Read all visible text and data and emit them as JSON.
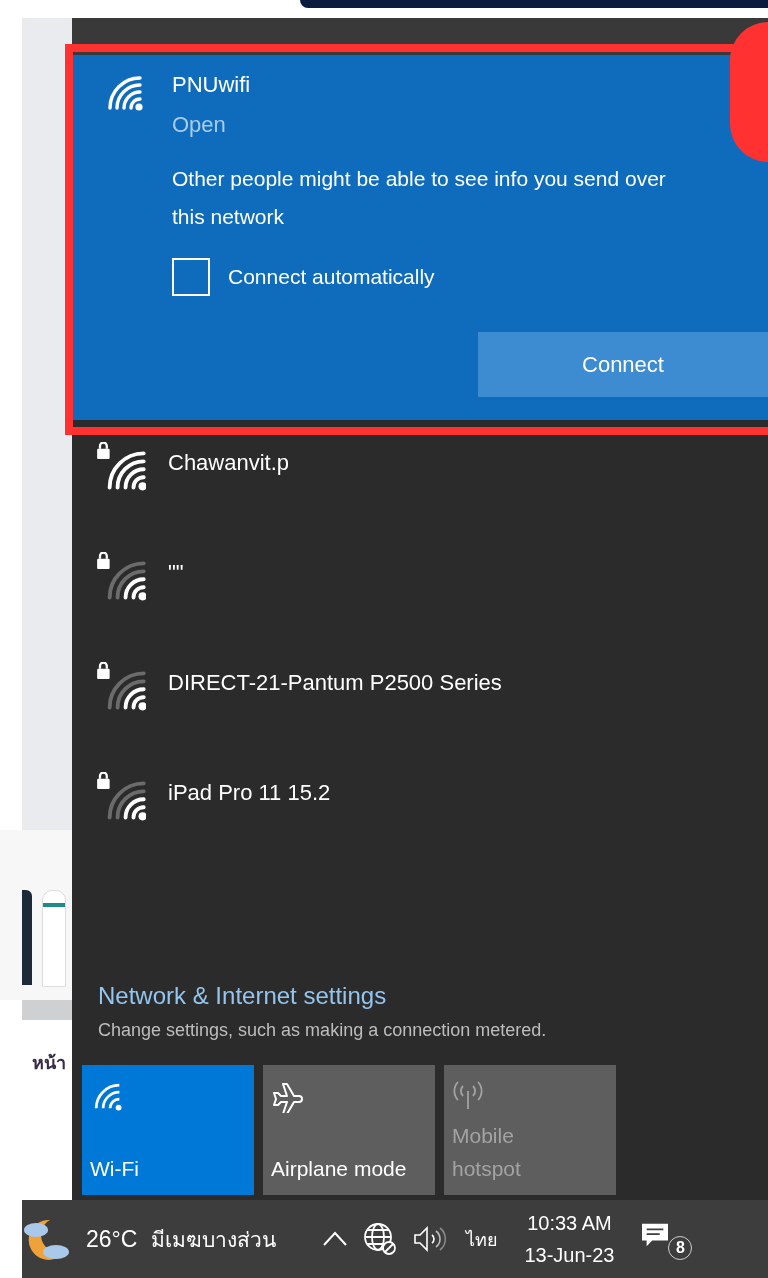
{
  "background": {
    "text": "หน้า"
  },
  "selected_network": {
    "name": "PNUwifi",
    "status": "Open",
    "warning": "Other people might be able to see info you send over this network",
    "connect_automatically": {
      "label": "Connect automatically",
      "checked": false
    },
    "connect_button": "Connect"
  },
  "networks": [
    {
      "name": "Chawanvit.p",
      "kind": "strong"
    },
    {
      "name": "\"\"",
      "kind": "weak"
    },
    {
      "name": "DIRECT-21-Pantum P2500 Series",
      "kind": "weak"
    },
    {
      "name": "iPad Pro 11 15.2",
      "kind": "weak"
    }
  ],
  "settings": {
    "link": "Network & Internet settings",
    "description": "Change settings, such as making a connection metered."
  },
  "quick_actions": [
    {
      "kind": "wifi",
      "label": "Wi-Fi",
      "on": true,
      "disabled": false
    },
    {
      "kind": "airplane",
      "label": "Airplane mode",
      "on": false,
      "disabled": false
    },
    {
      "kind": "hotspot",
      "label": "Mobile hotspot",
      "on": false,
      "disabled": true
    }
  ],
  "taskbar": {
    "temperature": "26°C",
    "weather": "มีเมฆบางส่วน",
    "language": "ไทย",
    "time": "10:33 AM",
    "date": "13-Jun-23",
    "notification_count": "8"
  }
}
